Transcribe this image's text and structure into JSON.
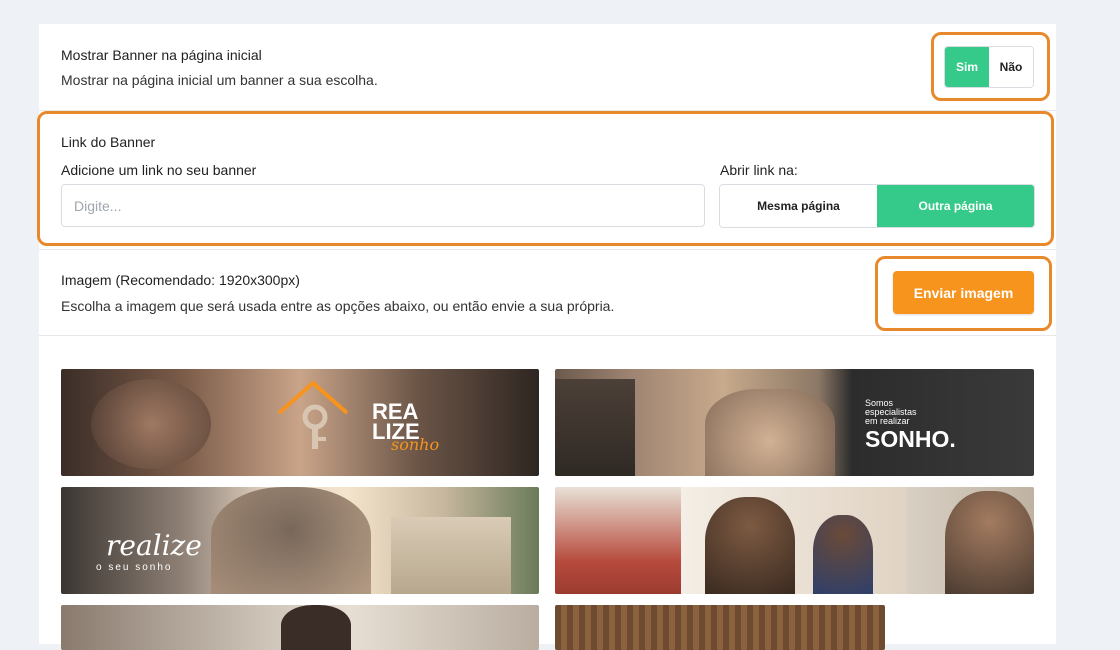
{
  "banner_toggle": {
    "title": "Mostrar Banner na página inicial",
    "subtitle": "Mostrar na página inicial um banner a sua escolha.",
    "yes_label": "Sim",
    "no_label": "Não",
    "selected": "Sim"
  },
  "banner_link": {
    "title": "Link do Banner",
    "input_label": "Adicione um link no seu banner",
    "input_placeholder": "Digite...",
    "input_value": "",
    "open_label": "Abrir link na:",
    "same_page_label": "Mesma página",
    "other_page_label": "Outra página",
    "selected": "Outra página"
  },
  "image_section": {
    "title": "Imagem (Recomendado: 1920x300px)",
    "subtitle": "Escolha a imagem que será usada entre as opções abaixo, ou então envie a sua própria.",
    "upload_label": "Enviar imagem"
  },
  "gallery": [
    {
      "name": "realize-keys",
      "text_line1": "REA",
      "text_line2": "LIZE",
      "script": "sonho"
    },
    {
      "name": "family-house",
      "small_text_1": "Somos",
      "small_text_2": "especialistas",
      "small_text_3": "em realizar",
      "big_text": "SONHO."
    },
    {
      "name": "couple-house",
      "script": "realize",
      "small_text": "o seu sonho"
    },
    {
      "name": "people-collage"
    },
    {
      "name": "partial-building"
    },
    {
      "name": "partial-interior"
    }
  ],
  "colors": {
    "accent_green": "#35c98a",
    "accent_orange": "#f7941d",
    "highlight_orange": "#e88a2c",
    "background": "#eef1f5"
  }
}
